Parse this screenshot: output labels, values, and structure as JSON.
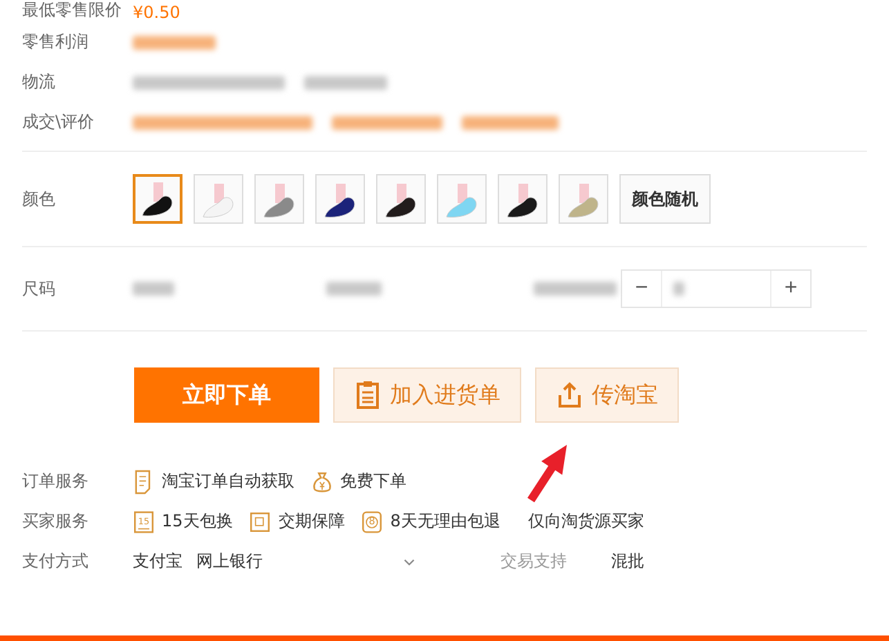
{
  "info_rows": [
    {
      "label": "最低零售限价",
      "value": "¥0.50"
    },
    {
      "label": "零售利润"
    },
    {
      "label": "物流"
    },
    {
      "label": "成交\\评价"
    }
  ],
  "color_options": [
    {
      "kind": "swatch",
      "color": "#111111",
      "selected": true
    },
    {
      "kind": "swatch",
      "color": "#f4f4f4",
      "selected": false
    },
    {
      "kind": "swatch",
      "color": "#8a8a8a",
      "selected": false
    },
    {
      "kind": "swatch",
      "color": "#1c237a",
      "selected": false
    },
    {
      "kind": "swatch",
      "color": "#221c1c",
      "selected": false
    },
    {
      "kind": "swatch",
      "color": "#7fd6f2",
      "selected": false
    },
    {
      "kind": "swatch",
      "color": "#1a1a1a",
      "selected": false
    },
    {
      "kind": "swatch",
      "color": "#bfb48a",
      "selected": false
    },
    {
      "kind": "text",
      "label": "颜色随机",
      "selected": false
    }
  ],
  "color_label": "颜色",
  "size_label": "尺码",
  "quantity": {
    "minus": "−",
    "plus": "+"
  },
  "buttons": [
    {
      "kind": "primary",
      "label": "立即下单"
    },
    {
      "kind": "list",
      "label": "加入进货单"
    },
    {
      "kind": "upload",
      "label": "传淘宝"
    }
  ],
  "services": [
    {
      "label": "订单服务",
      "items": [
        {
          "kind": "doc",
          "text": "淘宝订单自动获取"
        },
        {
          "kind": "money",
          "text": "免费下单"
        }
      ]
    },
    {
      "label": "买家服务",
      "items": [
        {
          "kind": "calendar",
          "num": "15",
          "text": "15天包换"
        },
        {
          "kind": "swap",
          "text": "交期保障"
        },
        {
          "kind": "badge",
          "num": "8",
          "text": "8天无理由包退"
        },
        {
          "kind": "plain",
          "text": "仅向淘货源买家"
        }
      ]
    }
  ],
  "payment": {
    "label": "支付方式",
    "methods": [
      "支付宝",
      "网上银行"
    ],
    "trade_label": "交易支持",
    "trade_value": "混批"
  }
}
